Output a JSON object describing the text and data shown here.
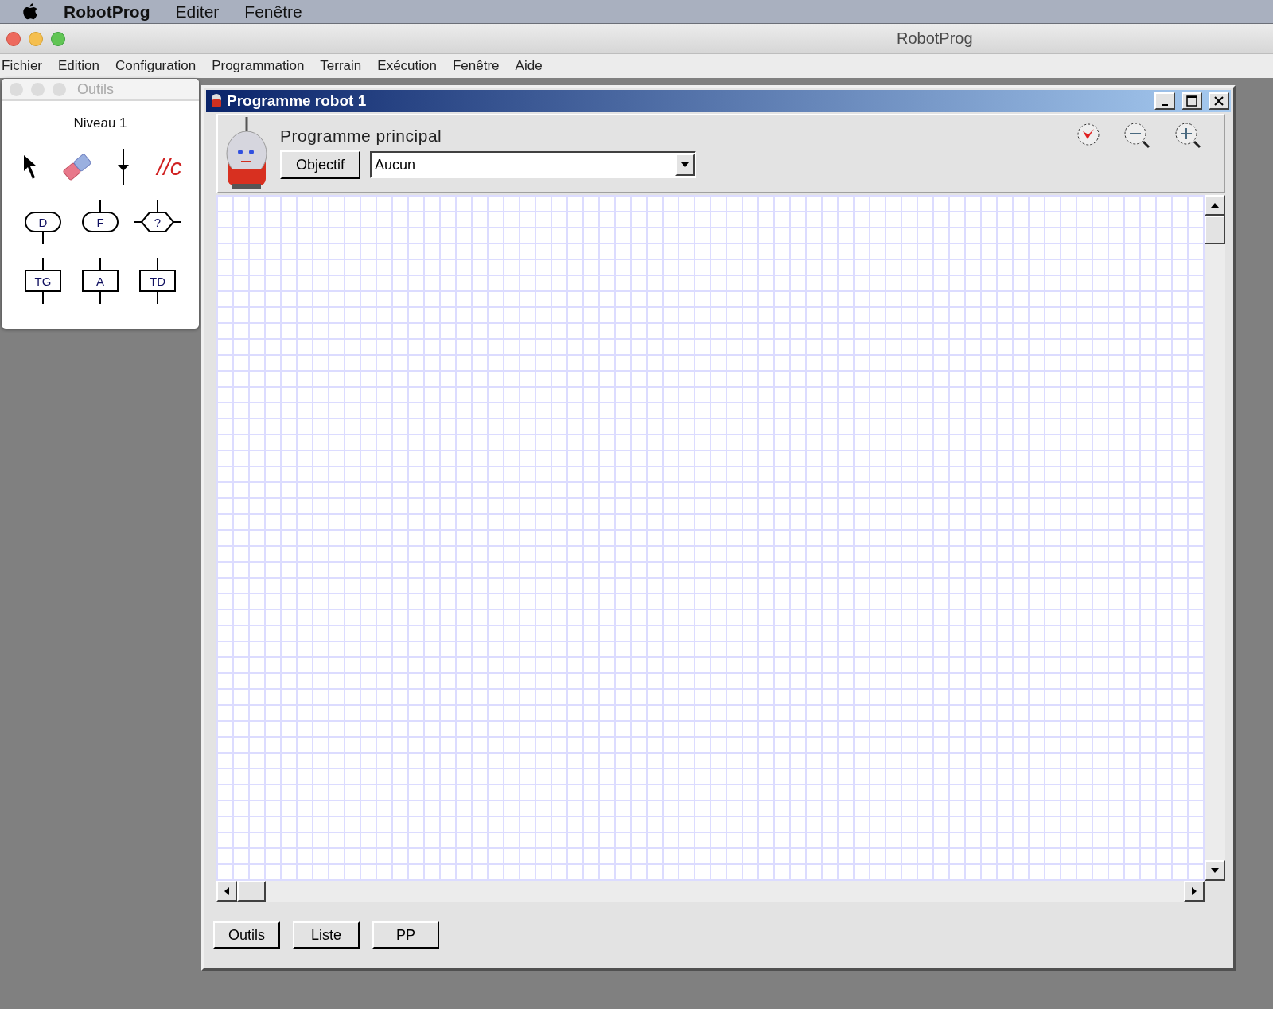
{
  "system_menu": {
    "app_name": "RobotProg",
    "items": [
      "Editer",
      "Fenêtre"
    ]
  },
  "app_window": {
    "title": "RobotProg"
  },
  "menu_bar": [
    "Fichier",
    "Edition",
    "Configuration",
    "Programmation",
    "Terrain",
    "Exécution",
    "Fenêtre",
    "Aide"
  ],
  "tools_palette": {
    "title": "Outils",
    "level": "Niveau 1",
    "tool_rows": [
      [
        {
          "kind": "pointer"
        },
        {
          "kind": "eraser"
        },
        {
          "kind": "link"
        },
        {
          "kind": "comment",
          "label": "//c"
        }
      ],
      [
        {
          "kind": "start",
          "label": "D"
        },
        {
          "kind": "end",
          "label": "F"
        },
        {
          "kind": "test",
          "label": "?"
        }
      ],
      [
        {
          "kind": "action",
          "label": "TG"
        },
        {
          "kind": "action",
          "label": "A"
        },
        {
          "kind": "action",
          "label": "TD"
        }
      ]
    ]
  },
  "program_window": {
    "title": "Programme robot 1",
    "header": "Programme principal",
    "objective_button": "Objectif",
    "objective_select": "Aucun",
    "bottom_buttons": [
      "Outils",
      "Liste",
      "PP"
    ]
  }
}
